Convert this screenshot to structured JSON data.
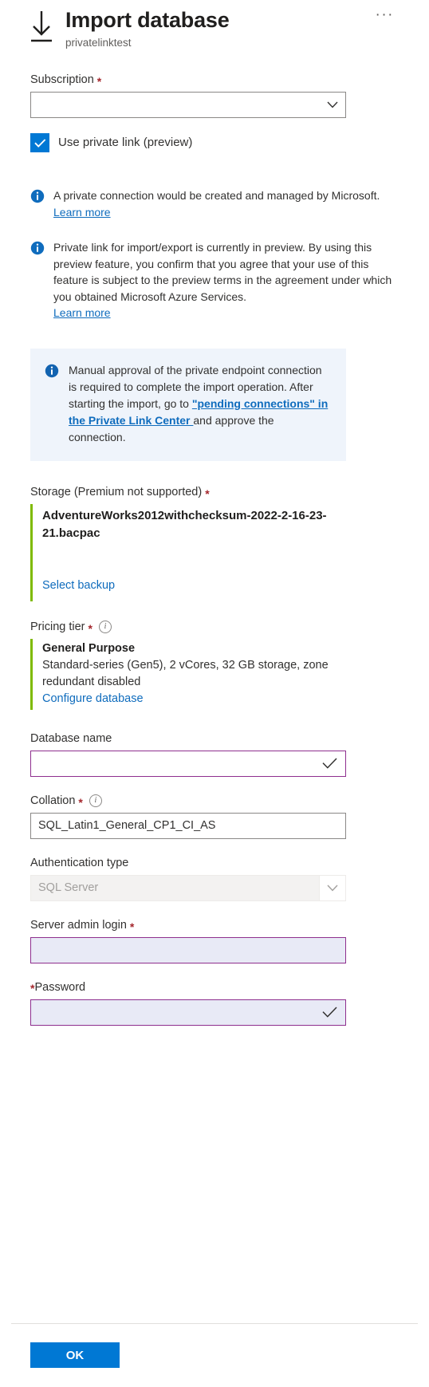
{
  "header": {
    "icon": "import-download-icon",
    "title": "Import database",
    "subtitle": "privatelinktest",
    "more_menu": "···"
  },
  "subscription": {
    "label": "Subscription",
    "required_marker": "*",
    "value": "",
    "chevron": "chevron-down-icon"
  },
  "private_link": {
    "checkbox_label": "Use private link (preview)",
    "checked": true
  },
  "messages": [
    {
      "icon": "info-icon",
      "text": "A private connection would be created and managed by Microsoft.",
      "link": "Learn more"
    },
    {
      "icon": "info-icon",
      "text": "Private link for import/export is currently in preview. By using this preview feature, you confirm that you agree that your use of this feature is subject to the preview terms in the agreement under which you obtained Microsoft Azure Services.",
      "link": "Learn more"
    }
  ],
  "callout": {
    "icon": "info-icon",
    "text_before": "Manual approval of the private endpoint connection is required to complete the import operation. After starting the import, go to ",
    "link_text": "\"pending connections\" in the Private Link Center ",
    "text_after": "and approve the connection."
  },
  "storage": {
    "label": "Storage (Premium not supported)",
    "required_marker": "*",
    "filename": "AdventureWorks2012withchecksum-2022-2-16-23-21.bacpac",
    "select_link": "Select backup"
  },
  "pricing_tier": {
    "label": "Pricing tier",
    "required_marker": "*",
    "info_icon": "info-circle-icon",
    "tier_name": "General Purpose",
    "tier_description": "Standard-series (Gen5), 2 vCores, 32 GB storage, zone redundant disabled",
    "configure_link": "Configure database"
  },
  "database_name": {
    "label": "Database name",
    "value": "",
    "state_icon": "checkmark-icon"
  },
  "collation": {
    "label": "Collation",
    "required_marker": "*",
    "info_icon": "info-circle-icon",
    "value": "SQL_Latin1_General_CP1_CI_AS"
  },
  "authentication_type": {
    "label": "Authentication type",
    "value": "SQL Server",
    "disabled": true,
    "chevron": "chevron-down-icon"
  },
  "server_admin_login": {
    "label": "Server admin login",
    "required_marker": "*",
    "value": ""
  },
  "password": {
    "required_marker": "*",
    "label": "Password",
    "value": "",
    "state_icon": "checkmark-icon"
  },
  "footer": {
    "ok_label": "OK"
  },
  "colors": {
    "accent_blue": "#0078d4",
    "link_blue": "#0f6cbd",
    "required_red": "#a4262c",
    "green_bar": "#7fba00",
    "autofill_purple_border": "#8e2f8e",
    "autofill_bg": "#e8eaf6",
    "callout_bg": "#eff4fb"
  }
}
